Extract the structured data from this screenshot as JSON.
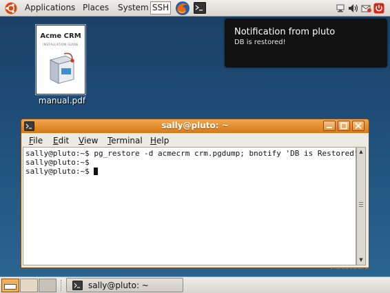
{
  "top_panel": {
    "menus": [
      "Applications",
      "Places",
      "System"
    ],
    "ssh_label": "SSH",
    "launchers": [
      "firefox-icon",
      "terminal-icon"
    ],
    "tray": [
      "network-icon",
      "volume-icon",
      "mail-icon",
      "power-icon"
    ]
  },
  "desktop": {
    "file_icon": {
      "label": "manual.pdf",
      "thumb_title": "Acme CRM",
      "thumb_subtitle": "INSTALLATION GUIDE"
    },
    "watermark": "viadstudio"
  },
  "notification": {
    "title": "Notification from pluto",
    "body": "DB is restored!"
  },
  "terminal": {
    "title": "sally@pluto: ~",
    "menu": [
      "File",
      "Edit",
      "View",
      "Terminal",
      "Help"
    ],
    "lines": [
      "sally@pluto:~$ pg_restore -d acmecrm crm.pgdump; bnotify 'DB is Restored!'",
      "sally@pluto:~$",
      "sally@pluto:~$ "
    ]
  },
  "bottom_panel": {
    "task_label": "sally@pluto: ~"
  },
  "colors": {
    "accent_orange": "#e08a2c",
    "desktop_blue": "#1f4f7b",
    "notify_bg": "#111111"
  }
}
